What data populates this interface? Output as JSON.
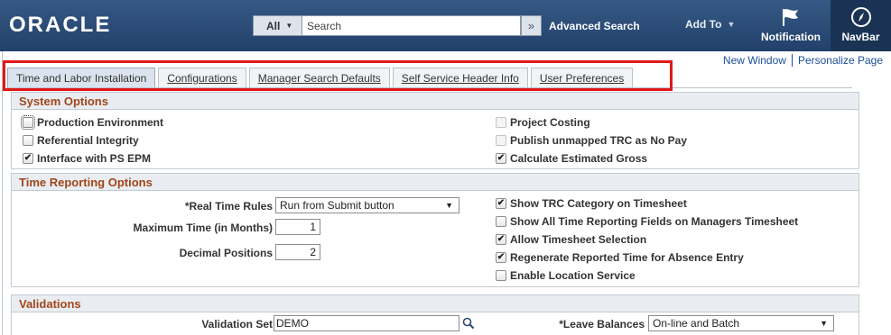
{
  "header": {
    "logo": "ORACLE",
    "search_scope": "All",
    "search_placeholder": "Search",
    "advanced_search": "Advanced Search",
    "add_to": "Add To",
    "notification": "Notification",
    "navbar": "NavBar",
    "colors": {
      "bar": "#2b4a71",
      "navbar": "#1a3354"
    }
  },
  "links": {
    "new_window": "New Window",
    "personalize": "Personalize Page"
  },
  "tabs": [
    {
      "label": "Time and Labor Installation",
      "active": true
    },
    {
      "label": "Configurations"
    },
    {
      "label": "Manager Search Defaults"
    },
    {
      "label": "Self Service Header Info"
    },
    {
      "label": "User Preferences"
    }
  ],
  "system_options": {
    "title": "System Options",
    "items": [
      {
        "label": "Production Environment",
        "checked": false
      },
      {
        "label": "Referential Integrity",
        "checked": false
      },
      {
        "label": "Interface with PS EPM",
        "checked": true
      },
      {
        "label": "Project Costing",
        "checked": false,
        "disabled": true
      },
      {
        "label": "Publish unmapped TRC as No Pay",
        "checked": false,
        "disabled": true
      },
      {
        "label": "Calculate Estimated Gross",
        "checked": true
      }
    ]
  },
  "time_reporting": {
    "title": "Time Reporting Options",
    "real_time_rules_label": "*Real Time Rules",
    "real_time_rules_value": "Run from Submit button",
    "max_time_label": "Maximum Time (in Months)",
    "max_time_value": "1",
    "decimal_label": "Decimal Positions",
    "decimal_value": "2",
    "items": [
      {
        "label": "Show TRC Category on Timesheet",
        "checked": true
      },
      {
        "label": "Show All Time Reporting Fields on Managers Timesheet",
        "checked": false
      },
      {
        "label": "Allow Timesheet Selection",
        "checked": true
      },
      {
        "label": "Regenerate Reported Time for Absence Entry",
        "checked": true
      },
      {
        "label": "Enable Location Service",
        "checked": false
      }
    ]
  },
  "validations": {
    "title": "Validations",
    "validation_set_label": "Validation Set",
    "validation_set_value": "DEMO",
    "leave_balances_label": "*Leave Balances",
    "leave_balances_value": "On-line and Batch"
  },
  "checkmark": "✔"
}
